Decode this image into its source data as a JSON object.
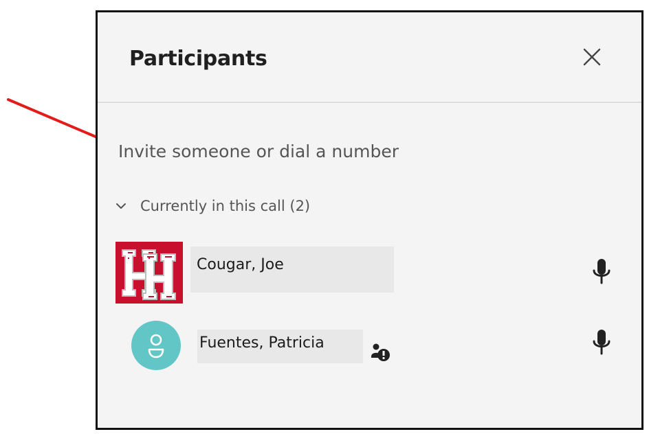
{
  "panel": {
    "title": "Participants",
    "close_icon": "close-icon"
  },
  "invite": {
    "placeholder": "Invite someone or dial a number"
  },
  "section": {
    "label": "Currently in this call (2)",
    "icon": "chevron-down-icon"
  },
  "participants": [
    {
      "name": "Cougar, Joe",
      "avatar": "university-logo",
      "mic_icon": "microphone-icon"
    },
    {
      "name": "Fuentes, Patricia",
      "avatar": "person-icon",
      "status_icon": "people-alert-icon",
      "mic_icon": "microphone-icon"
    }
  ],
  "colors": {
    "panel_background": "#f4f4f4",
    "avatar_teal": "#62c6c6",
    "logo_red": "#c8102e",
    "annotation_red": "#e21b1b",
    "text_primary": "#1f1f1f",
    "text_secondary": "#555555"
  }
}
